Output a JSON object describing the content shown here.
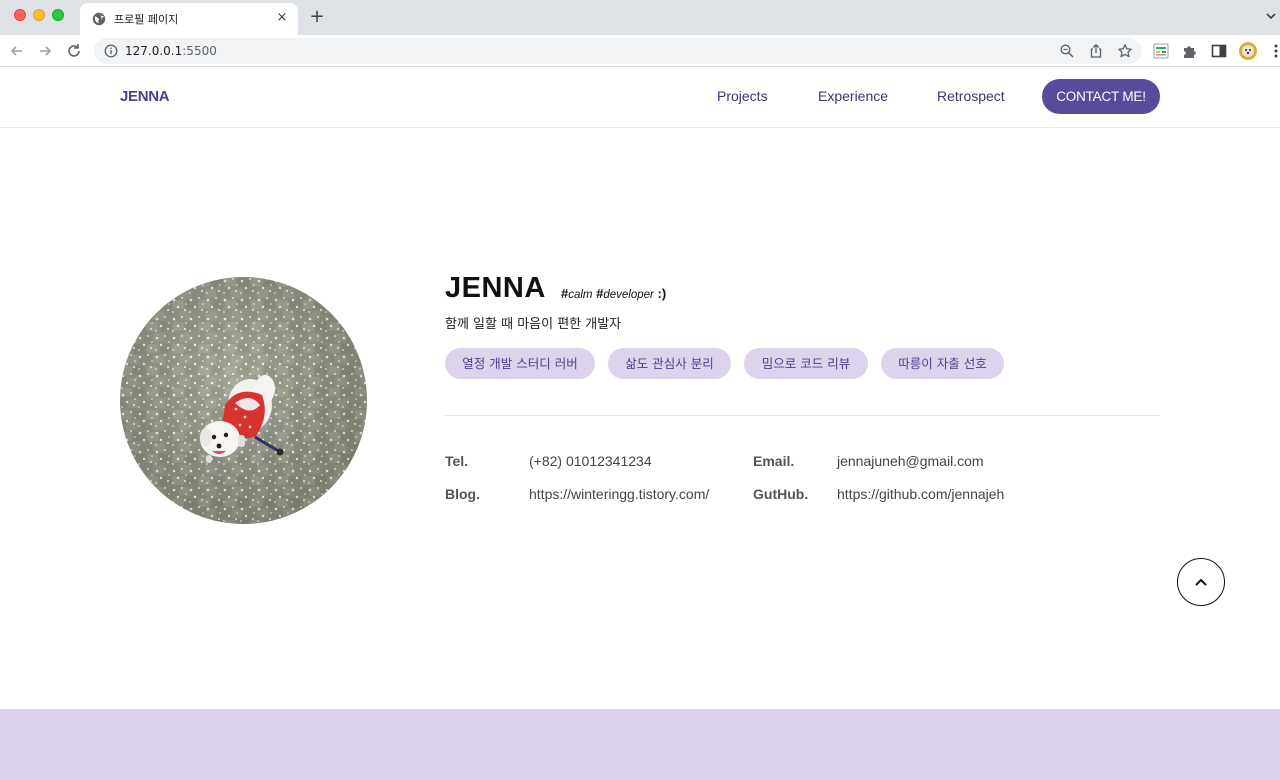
{
  "browser": {
    "tab_title": "프로필 페이지",
    "url_host": "127.0.0.1",
    "url_port": ":5500",
    "new_tab_symbol": "+",
    "close_symbol": "×"
  },
  "header": {
    "logo": "JENNA",
    "nav": [
      "Projects",
      "Experience",
      "Retrospect"
    ],
    "contact_button": "CONTACT ME!"
  },
  "profile": {
    "name": "JENNA",
    "hashtags": [
      {
        "hash": "#",
        "word": "calm"
      },
      {
        "hash": "#",
        "word": "developer"
      }
    ],
    "smile": ":)",
    "tagline": "함께 일할 때 마음이 편한 개발자",
    "chips": [
      "열정 개발 스터디 러버",
      "삶도 관심사 분리",
      "밈으로 코드 리뷰",
      "따릉이 자출 선호"
    ],
    "info": {
      "tel_label": "Tel.",
      "tel": "(+82) 01012341234",
      "email_label": "Email.",
      "email": "jennajuneh@gmail.com",
      "blog_label": "Blog.",
      "blog": "https://winteringg.tistory.com/",
      "github_label": "GutHub.",
      "github": "https://github.com/jennajeh"
    }
  },
  "colors": {
    "accent": "#594a9c",
    "chip_bg": "#ddd3ec",
    "footer_band": "#dcd1ea"
  }
}
